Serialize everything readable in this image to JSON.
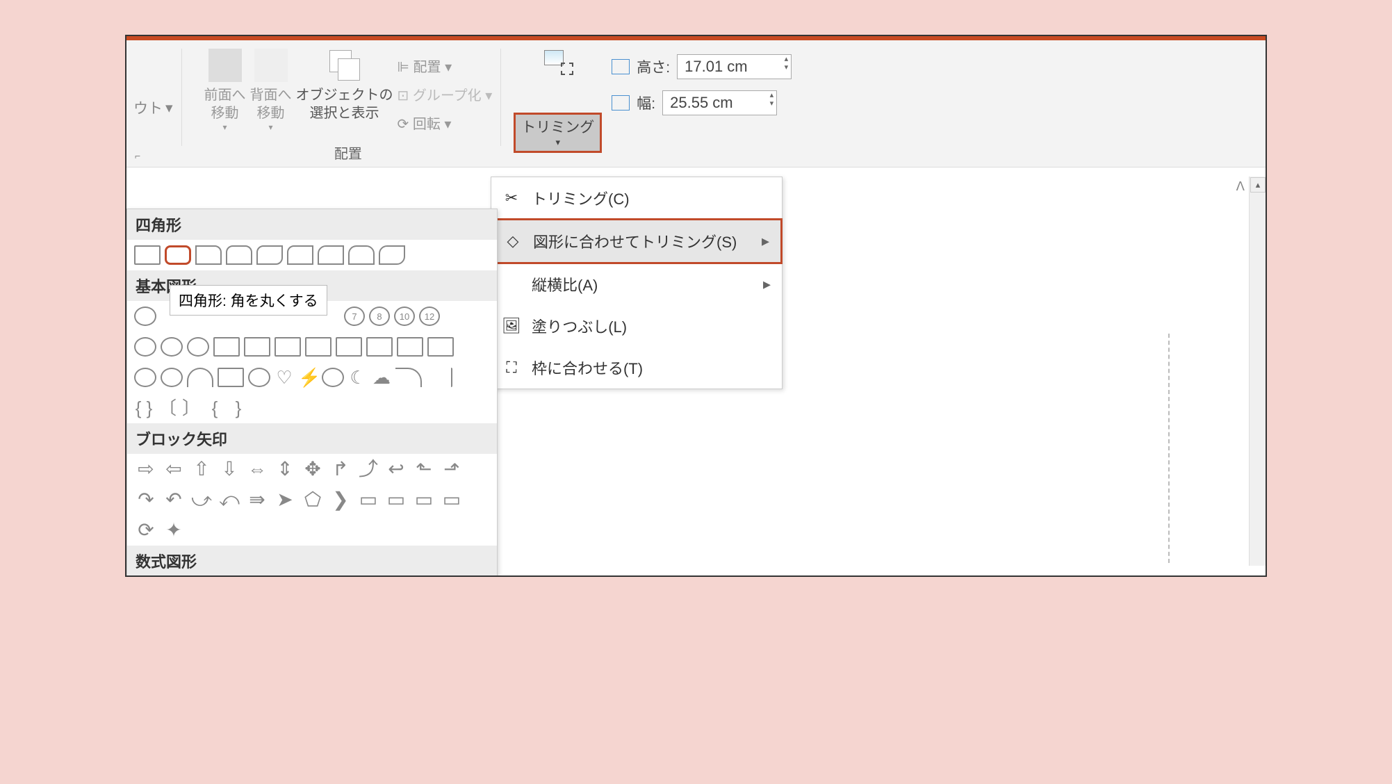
{
  "ribbon": {
    "partial_button": "ウト",
    "arrange": {
      "bring_forward": "前面へ\n移動",
      "send_backward": "背面へ\n移動",
      "selection_pane": "オブジェクトの\n選択と表示",
      "align": "配置",
      "group": "グループ化",
      "rotate": "回転",
      "group_label": "配置"
    },
    "crop_button": "トリミング",
    "size": {
      "height_label": "高さ:",
      "height_value": "17.01 cm",
      "width_label": "幅:",
      "width_value": "25.55 cm"
    }
  },
  "crop_menu": {
    "crop": "トリミング(C)",
    "crop_to_shape": "図形に合わせてトリミング(S)",
    "aspect_ratio": "縦横比(A)",
    "fill": "塗りつぶし(L)",
    "fit": "枠に合わせる(T)"
  },
  "shape_panel": {
    "rectangles": "四角形",
    "basic_shapes": "基本図形",
    "block_arrows": "ブロック矢印",
    "equation_shapes": "数式図形",
    "tooltip": "四角形: 角を丸くする",
    "num7": "7",
    "num8": "8",
    "num10": "10",
    "num12": "12"
  }
}
